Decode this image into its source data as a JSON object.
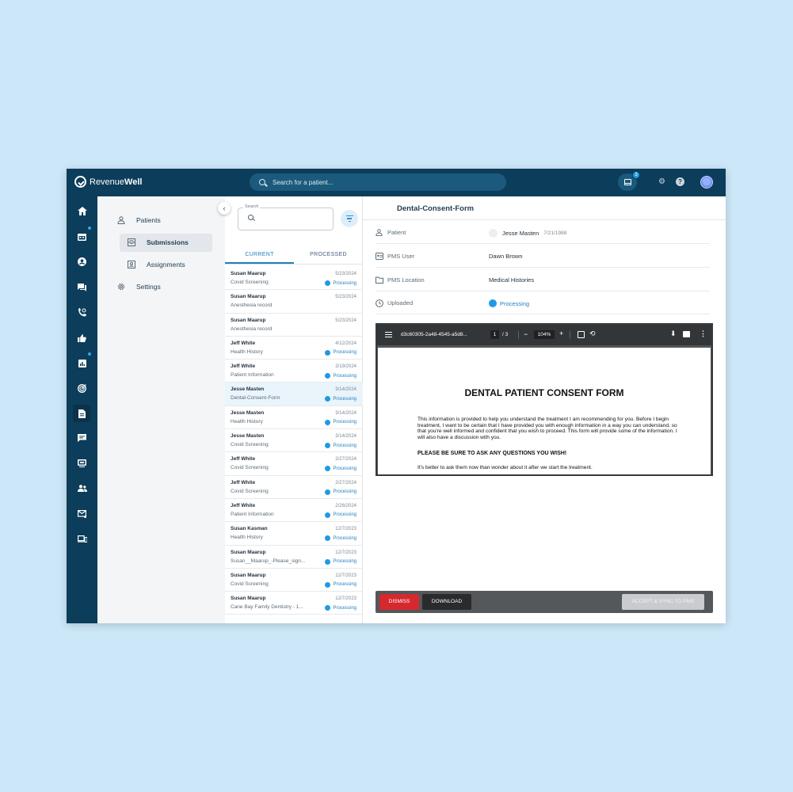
{
  "brand": {
    "name_light": "Revenue",
    "name_bold": "Well"
  },
  "topbar": {
    "search_placeholder": "Search for a patient...",
    "inbox_count": "3"
  },
  "rail": {
    "items": [
      "home-icon",
      "calendar-icon",
      "account-circle-icon",
      "chat-icon",
      "phone-icon",
      "thumbs-up-icon",
      "analytics-icon",
      "target-icon",
      "document-icon",
      "message-icon",
      "screen-icon",
      "group-icon",
      "mail-icon",
      "devices-icon"
    ]
  },
  "nav": {
    "patients": "Patients",
    "submissions": "Submissions",
    "assignments": "Assignments",
    "settings": "Settings"
  },
  "list": {
    "search_label": "Search",
    "tabs": [
      "CURRENT",
      "PROCESSED"
    ],
    "rows": [
      {
        "name": "Susan Maarup",
        "form": "Covid Screening",
        "date": "5/23/2024",
        "status": "Processing"
      },
      {
        "name": "Susan Maarup",
        "form": "Anesthesia record",
        "date": "5/23/2024",
        "status": ""
      },
      {
        "name": "Susan Maarup",
        "form": "Anesthesia record",
        "date": "5/23/2024",
        "status": ""
      },
      {
        "name": "Jeff White",
        "form": "Health History",
        "date": "4/12/2024",
        "status": "Processing"
      },
      {
        "name": "Jeff White",
        "form": "Patient Information",
        "date": "3/19/2024",
        "status": "Processing"
      },
      {
        "name": "Jesse Masten",
        "form": "Dental-Consent-Form",
        "date": "3/14/2024",
        "status": "Processing"
      },
      {
        "name": "Jesse Masten",
        "form": "Health History",
        "date": "3/14/2024",
        "status": "Processing"
      },
      {
        "name": "Jesse Masten",
        "form": "Covid Screening",
        "date": "3/14/2024",
        "status": "Processing"
      },
      {
        "name": "Jeff White",
        "form": "Covid Screening",
        "date": "2/27/2024",
        "status": "Processing"
      },
      {
        "name": "Jeff White",
        "form": "Covid Screening",
        "date": "2/27/2024",
        "status": "Processing"
      },
      {
        "name": "Jeff White",
        "form": "Patient Information",
        "date": "2/26/2024",
        "status": "Processing"
      },
      {
        "name": "Susan Kasman",
        "form": "Health History",
        "date": "12/7/2023",
        "status": "Processing"
      },
      {
        "name": "Susan Maarup",
        "form": "Susan__Maarup_-Please_sign...",
        "date": "12/7/2023",
        "status": "Processing"
      },
      {
        "name": "Susan Maarup",
        "form": "Covid Screening",
        "date": "12/7/2023",
        "status": "Processing"
      },
      {
        "name": "Susan Maarup",
        "form": "Cane Bay Family Dentistry - 1...",
        "date": "12/7/2023",
        "status": "Processing"
      }
    ]
  },
  "detail": {
    "title": "Dental-Consent-Form",
    "patient_label": "Patient",
    "patient_name": "Jesse Masten",
    "patient_dob": "7/21/1988",
    "pms_user_label": "PMS User",
    "pms_user": "Dawn Brown",
    "pms_location_label": "PMS Location",
    "pms_location": "Medical Histories",
    "uploaded_label": "Uploaded",
    "uploaded_status": "Processing"
  },
  "pdf": {
    "filename": "d3c60305-2a48-4545-a5d8...",
    "page": "1",
    "total": "/ 3",
    "zoom": "104%",
    "doc_title": "DENTAL PATIENT CONSENT FORM",
    "doc_para": "This information is provided to help you understand the treatment I am recommending for you. Before I begin treatment, I want to be certain that I have provided you with enough information in a way you can understand, so that you're well informed and confident that you wish to proceed. This form will provide some of the information. I will also have a discussion with you.",
    "doc_bold": "PLEASE BE SURE TO ASK ANY QUESTIONS YOU WISH!",
    "doc_last": "It's better to ask them now than wonder about it after we start the treatment."
  },
  "actions": {
    "dismiss": "DISMISS",
    "download": "DOWNLOAD",
    "accept": "ACCEPT & SYNC TO PMS"
  },
  "colors": {
    "topbar": "#0c3d5a",
    "accent": "#1f7fc2",
    "dismiss": "#d6282f",
    "background": "#cce7f8"
  }
}
